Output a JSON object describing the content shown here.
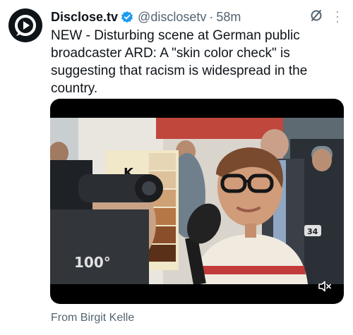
{
  "account": {
    "display_name": "Disclose.tv",
    "handle": "@disclosetv",
    "separator": "·",
    "time": "58m",
    "avatar_icon": "play-logo-icon",
    "verified_icon": "verified-badge-icon",
    "verified_color": "#1d9bf0"
  },
  "tweet": {
    "text": "NEW - Disturbing scene at German public broadcaster ARD: A \"skin color check\" is suggesting that racism is widespread in the country."
  },
  "media": {
    "type": "video",
    "watermark": "100°",
    "badge": "34",
    "mute_icon": "volume-muted-icon"
  },
  "attribution": "From Birgit Kelle",
  "icons": {
    "grok": "slashed-circle-icon",
    "more": "more-options-icon"
  }
}
